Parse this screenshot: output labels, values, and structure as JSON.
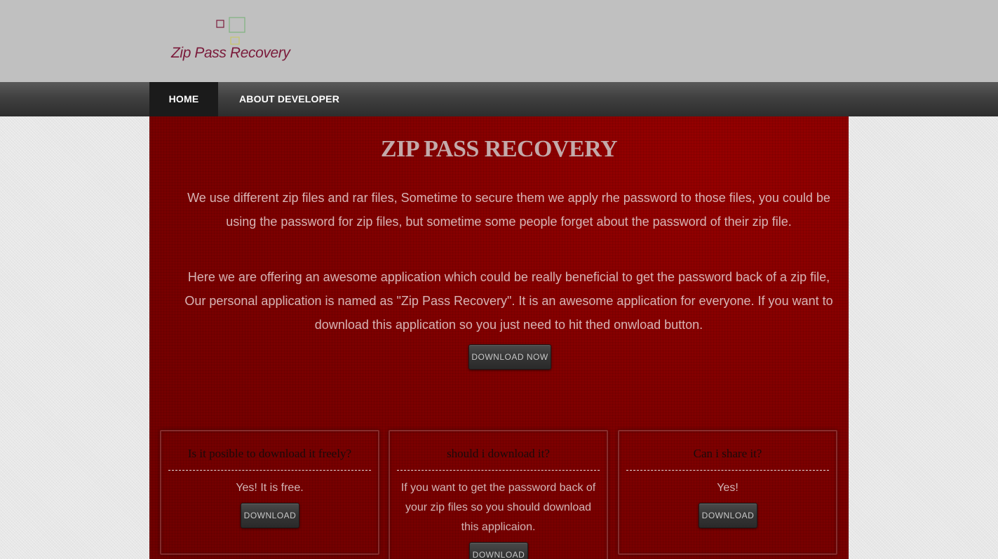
{
  "logo": {
    "text": "Zip Pass Recovery",
    "icon": "logo-squares-icon",
    "colors": {
      "text": "#7a1a3a",
      "square_red": "#7a1a3a",
      "square_green": "#7fb27f",
      "square_yellow": "#c8c86a"
    }
  },
  "nav": {
    "items": [
      {
        "label": "HOME",
        "active": true
      },
      {
        "label": "ABOUT DEVELOPER",
        "active": false
      }
    ]
  },
  "main": {
    "title": "ZIP PASS RECOVERY",
    "paragraph1": "We use different zip files and rar files, Sometime to secure them we apply rhe password to those files, you could be using the password for zip files, but sometime some people forget about the password of their zip file.",
    "paragraph2": "Here we are offering an awesome application which could be really beneficial to get the password back of a zip file, Our personal application is named as \"Zip Pass Recovery\". It is an awesome application for everyone. If you want to download this application so you just need to hit thed onwload button.",
    "download_button": "DOWNLOAD NOW"
  },
  "cards": [
    {
      "title": "Is it posible to download it freely?",
      "text": "Yes! It is free.",
      "button": "DOWNLOAD"
    },
    {
      "title": "should i download it?",
      "text": "If you want to get the password back of your zip files so you should download this applicaion.",
      "button": "DOWNLOAD"
    },
    {
      "title": "Can i share it?",
      "text": "Yes!",
      "button": "DOWNLOAD"
    }
  ],
  "colors": {
    "header_bg": "#c0c0c0",
    "nav_bg": "#3a3a3a",
    "nav_active_bg": "#1b1b1b",
    "main_bg": "#7c0000",
    "page_bg": "#e7e7e7"
  }
}
